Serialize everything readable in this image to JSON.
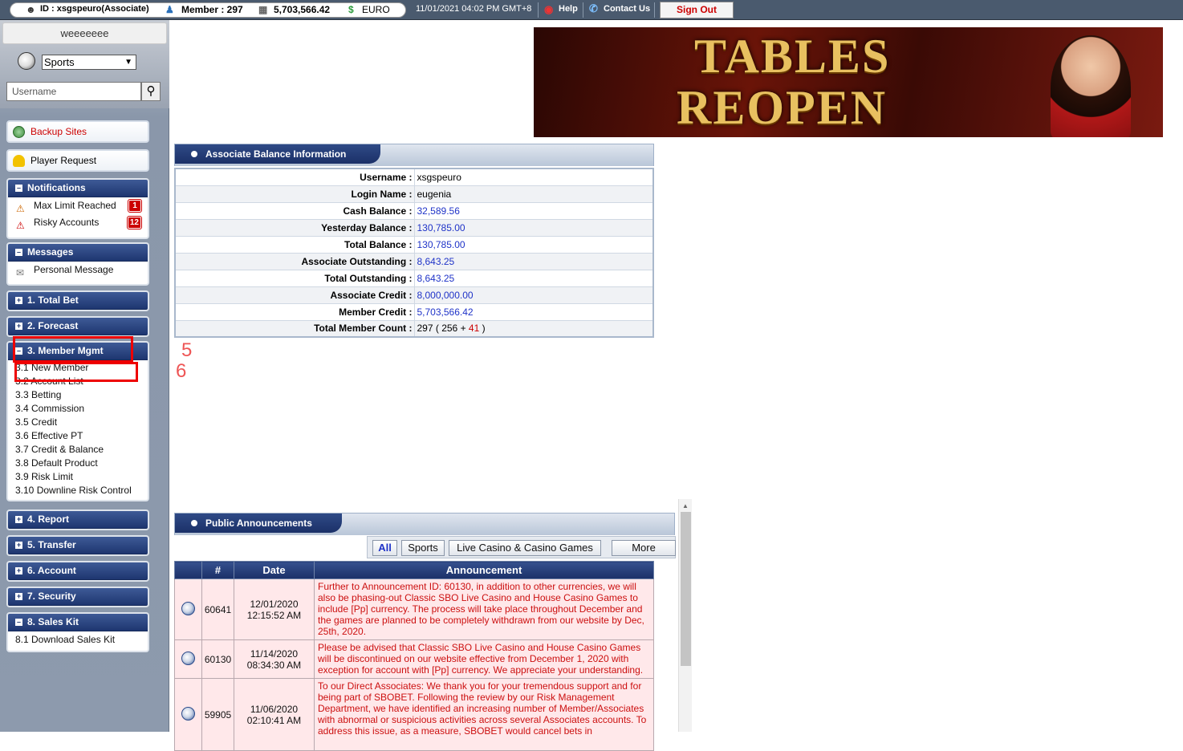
{
  "topbar": {
    "id_label": "ID : xsgspeuro(Associate)",
    "member_label": "Member : 297",
    "balance": "5,703,566.42",
    "currency": "EURO",
    "datetime": "11/01/2021 04:02 PM GMT+8",
    "help": "Help",
    "contact": "Contact Us",
    "signout": "Sign Out"
  },
  "sidebar": {
    "user": "weeeeeee",
    "product_select": "Sports",
    "search_placeholder": "Username",
    "backup_sites": "Backup Sites",
    "player_request": "Player Request",
    "notifications": {
      "title": "Notifications",
      "items": [
        {
          "label": "Max Limit Reached",
          "count": "1"
        },
        {
          "label": "Risky Accounts",
          "count": "12"
        }
      ]
    },
    "messages": {
      "title": "Messages",
      "items": [
        {
          "label": "Personal Message"
        }
      ]
    },
    "menus": [
      {
        "label": "1. Total Bet"
      },
      {
        "label": "2. Forecast"
      },
      {
        "label": "3. Member Mgmt"
      },
      {
        "label": "4. Report"
      },
      {
        "label": "5. Transfer"
      },
      {
        "label": "6. Account"
      },
      {
        "label": "7. Security"
      },
      {
        "label": "8. Sales Kit"
      }
    ],
    "member_mgmt_items": [
      "3.1 New Member",
      "3.2 Account List",
      "3.3 Betting",
      "3.4 Commission",
      "3.5 Credit",
      "3.6 Effective PT",
      "3.7 Credit & Balance",
      "3.8 Default Product",
      "3.9 Risk Limit",
      "3.10 Downline Risk Control"
    ],
    "sales_kit_items": [
      "8.1 Download Sales Kit"
    ]
  },
  "annotations": {
    "label_5": "5",
    "label_6": "6"
  },
  "banner": {
    "line1": "TABLES",
    "line2": "REOPEN"
  },
  "balance": {
    "title": "Associate Balance Information",
    "rows": [
      {
        "label": "Username :",
        "value": "xsgspeuro"
      },
      {
        "label": "Login Name :",
        "value": "eugenia"
      },
      {
        "label": "Cash Balance :",
        "value": "32,589.56"
      },
      {
        "label": "Yesterday Balance :",
        "value": "130,785.00"
      },
      {
        "label": "Total Balance :",
        "value": "130,785.00"
      },
      {
        "label": "Associate Outstanding :",
        "value": "8,643.25"
      },
      {
        "label": "Total Outstanding :",
        "value": "8,643.25"
      },
      {
        "label": "Associate Credit :",
        "value": "8,000,000.00"
      },
      {
        "label": "Member Credit :",
        "value": "5,703,566.42"
      },
      {
        "label": "Total Member Count :",
        "count_total": "297",
        "count_a": "256",
        "count_b": "41"
      }
    ]
  },
  "announcements": {
    "title": "Public Announcements",
    "filters": [
      "All",
      "Sports",
      "Live Casino & Casino Games",
      "More"
    ],
    "columns": [
      "#",
      "Date",
      "Announcement"
    ],
    "rows": [
      {
        "id": "60641",
        "date": "12/01/2020",
        "time": "12:15:52 AM",
        "text": "Further to Announcement ID: 60130, in addition to other currencies, we will also be phasing-out Classic SBO Live Casino and House Casino Games to include [Pp] currency. The process will take place throughout December and the games are planned to be completely withdrawn from our website by Dec, 25th, 2020."
      },
      {
        "id": "60130",
        "date": "11/14/2020",
        "time": "08:34:30 AM",
        "text": "Please be advised that Classic SBO Live Casino and House Casino Games will be discontinued on our website effective from December 1, 2020 with exception for account with [Pp] currency. We appreciate your understanding."
      },
      {
        "id": "59905",
        "date": "11/06/2020",
        "time": "02:10:41 AM",
        "text": "To our Direct Associates: We thank you for your tremendous support and for being part of SBOBET. Following the review by our Risk Management Department, we have identified an increasing number of Member/Associates with abnormal or suspicious activities across several Associates accounts. To address this issue, as a measure, SBOBET would cancel bets in"
      }
    ]
  }
}
